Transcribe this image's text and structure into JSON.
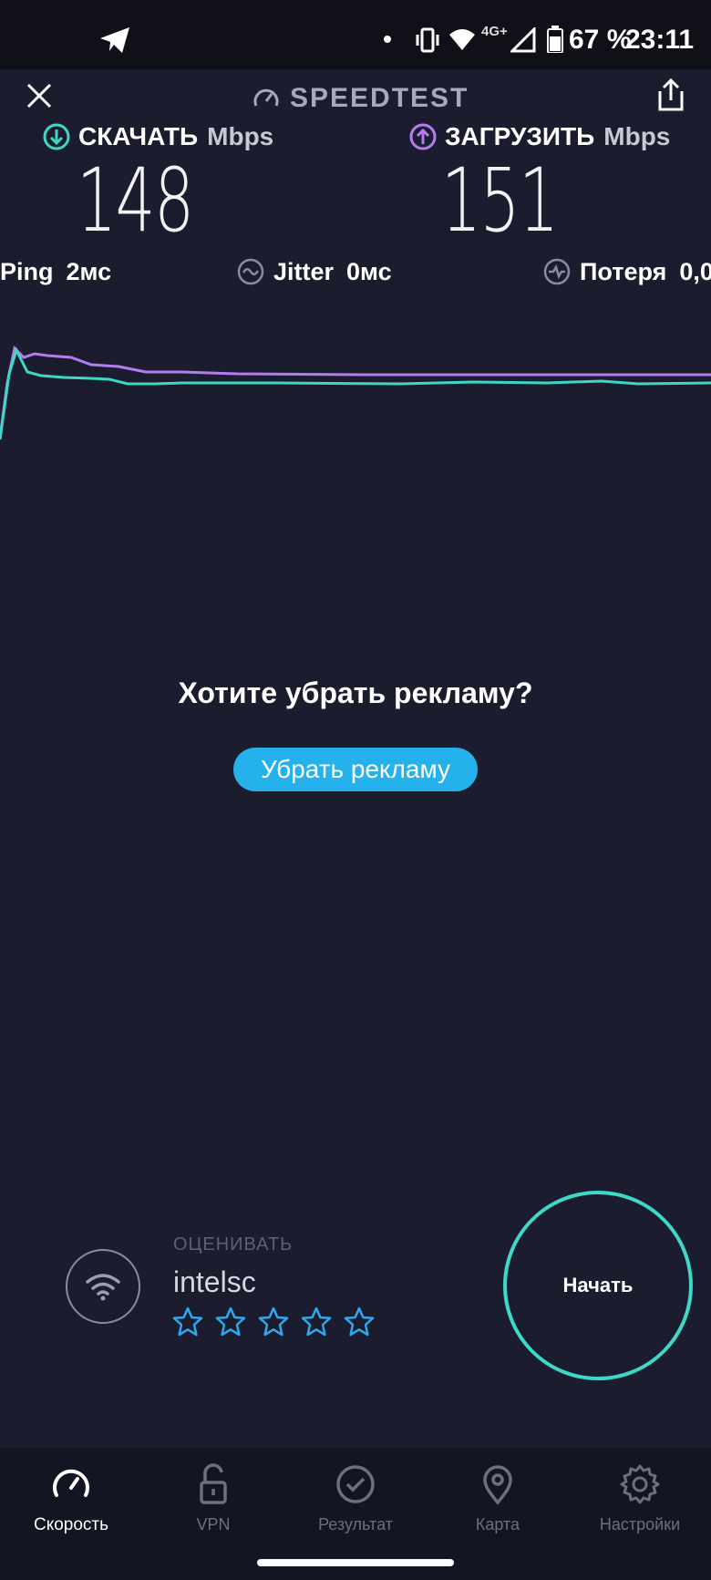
{
  "status_bar": {
    "network_type": "4G+",
    "battery": "67 %",
    "time": "23:11"
  },
  "header": {
    "title": "SPEEDTEST"
  },
  "download": {
    "label": "СКАЧАТЬ",
    "unit": "Mbps",
    "value": "148"
  },
  "upload": {
    "label": "ЗАГРУЗИТЬ",
    "unit": "Mbps",
    "value": "151"
  },
  "stats": {
    "ping_label": "Ping",
    "ping_value": "2мс",
    "jitter_label": "Jitter",
    "jitter_value": "0мс",
    "loss_label": "Потеря",
    "loss_value": "0,0"
  },
  "colors": {
    "download": "#3ed8c6",
    "upload": "#b47cf2",
    "accent_button": "#24b1ec",
    "background": "#1b1c2e"
  },
  "ad": {
    "question": "Хотите убрать рекламу?",
    "button": "Убрать рекламу"
  },
  "provider": {
    "rate_label": "ОЦЕНИВАТЬ",
    "name": "intelsc",
    "rating": 0,
    "rating_max": 5
  },
  "start_button": "Начать",
  "nav": {
    "items": [
      {
        "label": "Скорость",
        "icon": "speedometer-icon",
        "active": true
      },
      {
        "label": "VPN",
        "icon": "lock-icon",
        "active": false
      },
      {
        "label": "Результат",
        "icon": "check-circle-icon",
        "active": false
      },
      {
        "label": "Карта",
        "icon": "map-pin-icon",
        "active": false
      },
      {
        "label": "Настройки",
        "icon": "gear-icon",
        "active": false
      }
    ]
  }
}
